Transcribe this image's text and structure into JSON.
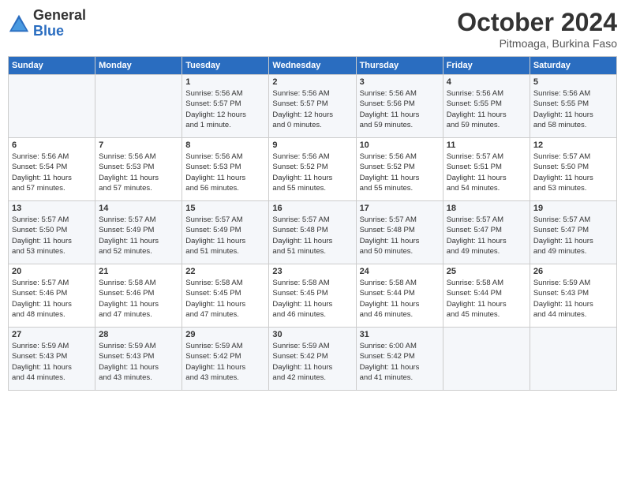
{
  "header": {
    "logo": {
      "general": "General",
      "blue": "Blue"
    },
    "title": "October 2024",
    "subtitle": "Pitmoaga, Burkina Faso"
  },
  "calendar": {
    "days_of_week": [
      "Sunday",
      "Monday",
      "Tuesday",
      "Wednesday",
      "Thursday",
      "Friday",
      "Saturday"
    ],
    "weeks": [
      [
        {
          "day": "",
          "info": ""
        },
        {
          "day": "",
          "info": ""
        },
        {
          "day": "1",
          "info": "Sunrise: 5:56 AM\nSunset: 5:57 PM\nDaylight: 12 hours\nand 1 minute."
        },
        {
          "day": "2",
          "info": "Sunrise: 5:56 AM\nSunset: 5:57 PM\nDaylight: 12 hours\nand 0 minutes."
        },
        {
          "day": "3",
          "info": "Sunrise: 5:56 AM\nSunset: 5:56 PM\nDaylight: 11 hours\nand 59 minutes."
        },
        {
          "day": "4",
          "info": "Sunrise: 5:56 AM\nSunset: 5:55 PM\nDaylight: 11 hours\nand 59 minutes."
        },
        {
          "day": "5",
          "info": "Sunrise: 5:56 AM\nSunset: 5:55 PM\nDaylight: 11 hours\nand 58 minutes."
        }
      ],
      [
        {
          "day": "6",
          "info": "Sunrise: 5:56 AM\nSunset: 5:54 PM\nDaylight: 11 hours\nand 57 minutes."
        },
        {
          "day": "7",
          "info": "Sunrise: 5:56 AM\nSunset: 5:53 PM\nDaylight: 11 hours\nand 57 minutes."
        },
        {
          "day": "8",
          "info": "Sunrise: 5:56 AM\nSunset: 5:53 PM\nDaylight: 11 hours\nand 56 minutes."
        },
        {
          "day": "9",
          "info": "Sunrise: 5:56 AM\nSunset: 5:52 PM\nDaylight: 11 hours\nand 55 minutes."
        },
        {
          "day": "10",
          "info": "Sunrise: 5:56 AM\nSunset: 5:52 PM\nDaylight: 11 hours\nand 55 minutes."
        },
        {
          "day": "11",
          "info": "Sunrise: 5:57 AM\nSunset: 5:51 PM\nDaylight: 11 hours\nand 54 minutes."
        },
        {
          "day": "12",
          "info": "Sunrise: 5:57 AM\nSunset: 5:50 PM\nDaylight: 11 hours\nand 53 minutes."
        }
      ],
      [
        {
          "day": "13",
          "info": "Sunrise: 5:57 AM\nSunset: 5:50 PM\nDaylight: 11 hours\nand 53 minutes."
        },
        {
          "day": "14",
          "info": "Sunrise: 5:57 AM\nSunset: 5:49 PM\nDaylight: 11 hours\nand 52 minutes."
        },
        {
          "day": "15",
          "info": "Sunrise: 5:57 AM\nSunset: 5:49 PM\nDaylight: 11 hours\nand 51 minutes."
        },
        {
          "day": "16",
          "info": "Sunrise: 5:57 AM\nSunset: 5:48 PM\nDaylight: 11 hours\nand 51 minutes."
        },
        {
          "day": "17",
          "info": "Sunrise: 5:57 AM\nSunset: 5:48 PM\nDaylight: 11 hours\nand 50 minutes."
        },
        {
          "day": "18",
          "info": "Sunrise: 5:57 AM\nSunset: 5:47 PM\nDaylight: 11 hours\nand 49 minutes."
        },
        {
          "day": "19",
          "info": "Sunrise: 5:57 AM\nSunset: 5:47 PM\nDaylight: 11 hours\nand 49 minutes."
        }
      ],
      [
        {
          "day": "20",
          "info": "Sunrise: 5:57 AM\nSunset: 5:46 PM\nDaylight: 11 hours\nand 48 minutes."
        },
        {
          "day": "21",
          "info": "Sunrise: 5:58 AM\nSunset: 5:46 PM\nDaylight: 11 hours\nand 47 minutes."
        },
        {
          "day": "22",
          "info": "Sunrise: 5:58 AM\nSunset: 5:45 PM\nDaylight: 11 hours\nand 47 minutes."
        },
        {
          "day": "23",
          "info": "Sunrise: 5:58 AM\nSunset: 5:45 PM\nDaylight: 11 hours\nand 46 minutes."
        },
        {
          "day": "24",
          "info": "Sunrise: 5:58 AM\nSunset: 5:44 PM\nDaylight: 11 hours\nand 46 minutes."
        },
        {
          "day": "25",
          "info": "Sunrise: 5:58 AM\nSunset: 5:44 PM\nDaylight: 11 hours\nand 45 minutes."
        },
        {
          "day": "26",
          "info": "Sunrise: 5:59 AM\nSunset: 5:43 PM\nDaylight: 11 hours\nand 44 minutes."
        }
      ],
      [
        {
          "day": "27",
          "info": "Sunrise: 5:59 AM\nSunset: 5:43 PM\nDaylight: 11 hours\nand 44 minutes."
        },
        {
          "day": "28",
          "info": "Sunrise: 5:59 AM\nSunset: 5:43 PM\nDaylight: 11 hours\nand 43 minutes."
        },
        {
          "day": "29",
          "info": "Sunrise: 5:59 AM\nSunset: 5:42 PM\nDaylight: 11 hours\nand 43 minutes."
        },
        {
          "day": "30",
          "info": "Sunrise: 5:59 AM\nSunset: 5:42 PM\nDaylight: 11 hours\nand 42 minutes."
        },
        {
          "day": "31",
          "info": "Sunrise: 6:00 AM\nSunset: 5:42 PM\nDaylight: 11 hours\nand 41 minutes."
        },
        {
          "day": "",
          "info": ""
        },
        {
          "day": "",
          "info": ""
        }
      ]
    ]
  }
}
